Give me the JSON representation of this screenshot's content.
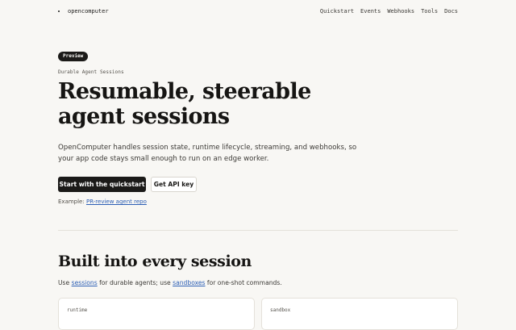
{
  "nav": {
    "brand": "opencomputer",
    "links": [
      "Quickstart",
      "Events",
      "Webhooks",
      "Tools",
      "Docs"
    ]
  },
  "hero": {
    "badge": "Preview",
    "eyebrow": "Durable Agent Sessions",
    "title_line1": "Resumable, steerable",
    "title_line2": "agent sessions",
    "description": "OpenComputer handles session state, runtime lifecycle, streaming, and webhooks, so your app code stays small enough to run on an edge worker.",
    "primary_button": "Start with the quickstart",
    "secondary_button": "Get API key",
    "example_prefix": "Example:",
    "example_link": "PR-review agent repo"
  },
  "section": {
    "heading": "Built into every session",
    "lead_1": "Use",
    "lead_link_1": "sessions",
    "lead_2": "for durable agents; use",
    "lead_link_2": "sandboxes",
    "lead_3": "for one-shot commands.",
    "cards": [
      {
        "tag": "runtime",
        "title": ""
      },
      {
        "tag": "sandbox",
        "title": ""
      }
    ]
  }
}
